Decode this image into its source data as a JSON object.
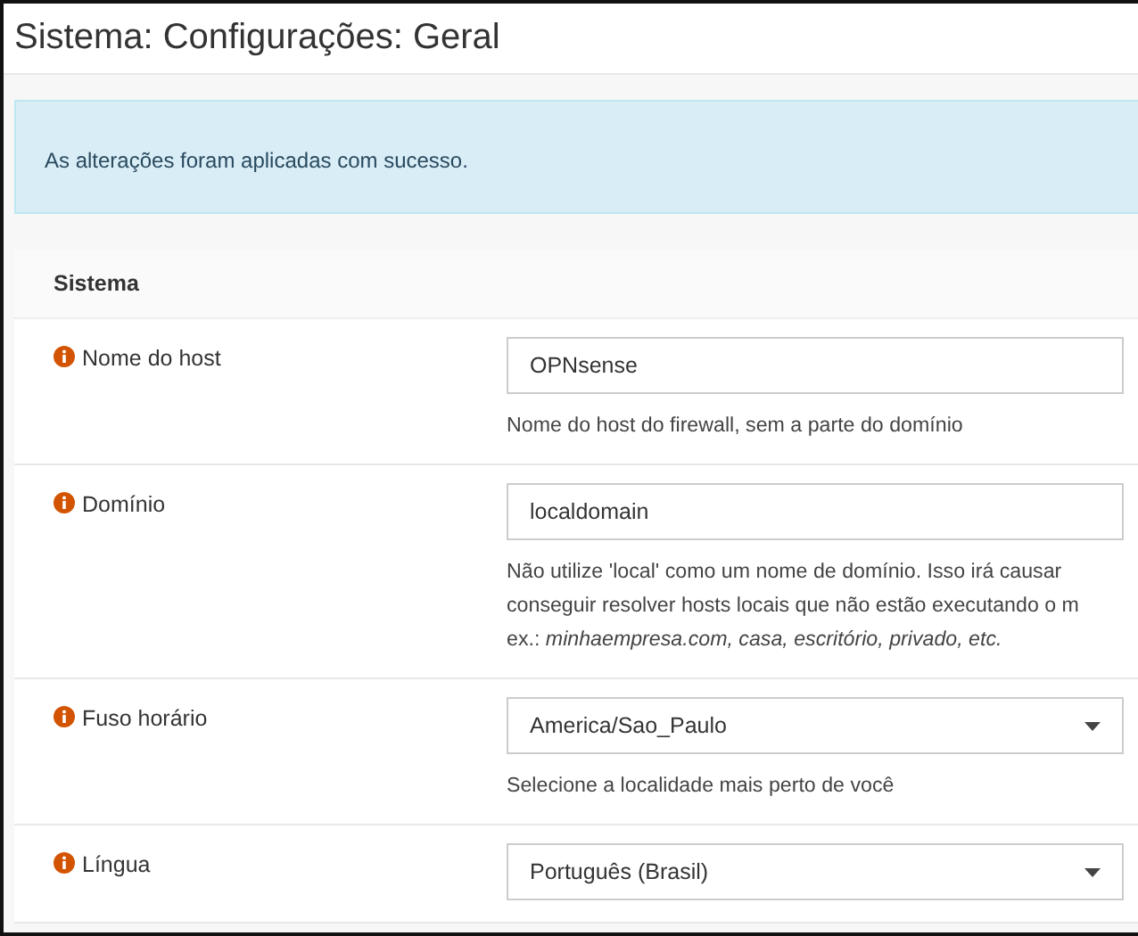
{
  "page_title": "Sistema: Configurações: Geral",
  "alert": "As alterações foram aplicadas com sucesso.",
  "section": {
    "title": "Sistema",
    "fields": [
      {
        "kind": "text",
        "label": "Nome do host",
        "value": "OPNsense",
        "help": [
          "Nome do host do firewall, sem a parte do domínio"
        ]
      },
      {
        "kind": "text",
        "label": "Domínio",
        "value": "localdomain",
        "help": [
          "Não utilize 'local' como um nome de domínio. Isso irá causar",
          "conseguir resolver hosts locais que não estão executando o m",
          "ex.: *minhaempresa.com, casa, escritório, privado, etc.*"
        ]
      },
      {
        "kind": "select",
        "label": "Fuso horário",
        "value": "America/Sao_Paulo",
        "help": [
          "Selecione a localidade mais perto de você"
        ]
      },
      {
        "kind": "select",
        "label": "Língua",
        "value": "Português (Brasil)"
      }
    ]
  }
}
